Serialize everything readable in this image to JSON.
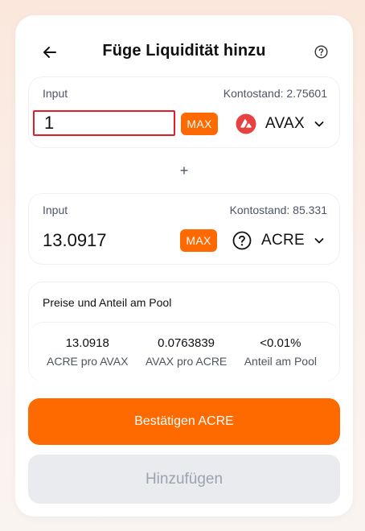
{
  "header": {
    "title": "Füge Liquidität hinzu",
    "back_icon": "arrow-left-icon",
    "help_icon": "question-circle-icon"
  },
  "input_a": {
    "label": "Input",
    "balance": "Kontostand: 2.75601",
    "value": "1",
    "max_label": "MAX",
    "token": "AVAX",
    "token_icon": "avax-logo-icon",
    "token_color": "#e84142"
  },
  "plus": "+",
  "input_b": {
    "label": "Input",
    "balance": "Kontostand: 85.331",
    "value": "13.0917",
    "max_label": "MAX",
    "token": "ACRE",
    "token_icon": "question-circle-icon"
  },
  "pool": {
    "title": "Preise und Anteil am Pool",
    "stats": [
      {
        "value": "13.0918",
        "label": "ACRE pro AVAX"
      },
      {
        "value": "0.0763839",
        "label": "AVAX pro ACRE"
      },
      {
        "value": "<0.01%",
        "label": "Anteil am Pool"
      }
    ]
  },
  "buttons": {
    "confirm": "Bestätigen ACRE",
    "add": "Hinzufügen"
  },
  "colors": {
    "accent": "#ff6a00",
    "error_outline": "#e11d2a",
    "disabled_bg": "#e9ebef"
  }
}
